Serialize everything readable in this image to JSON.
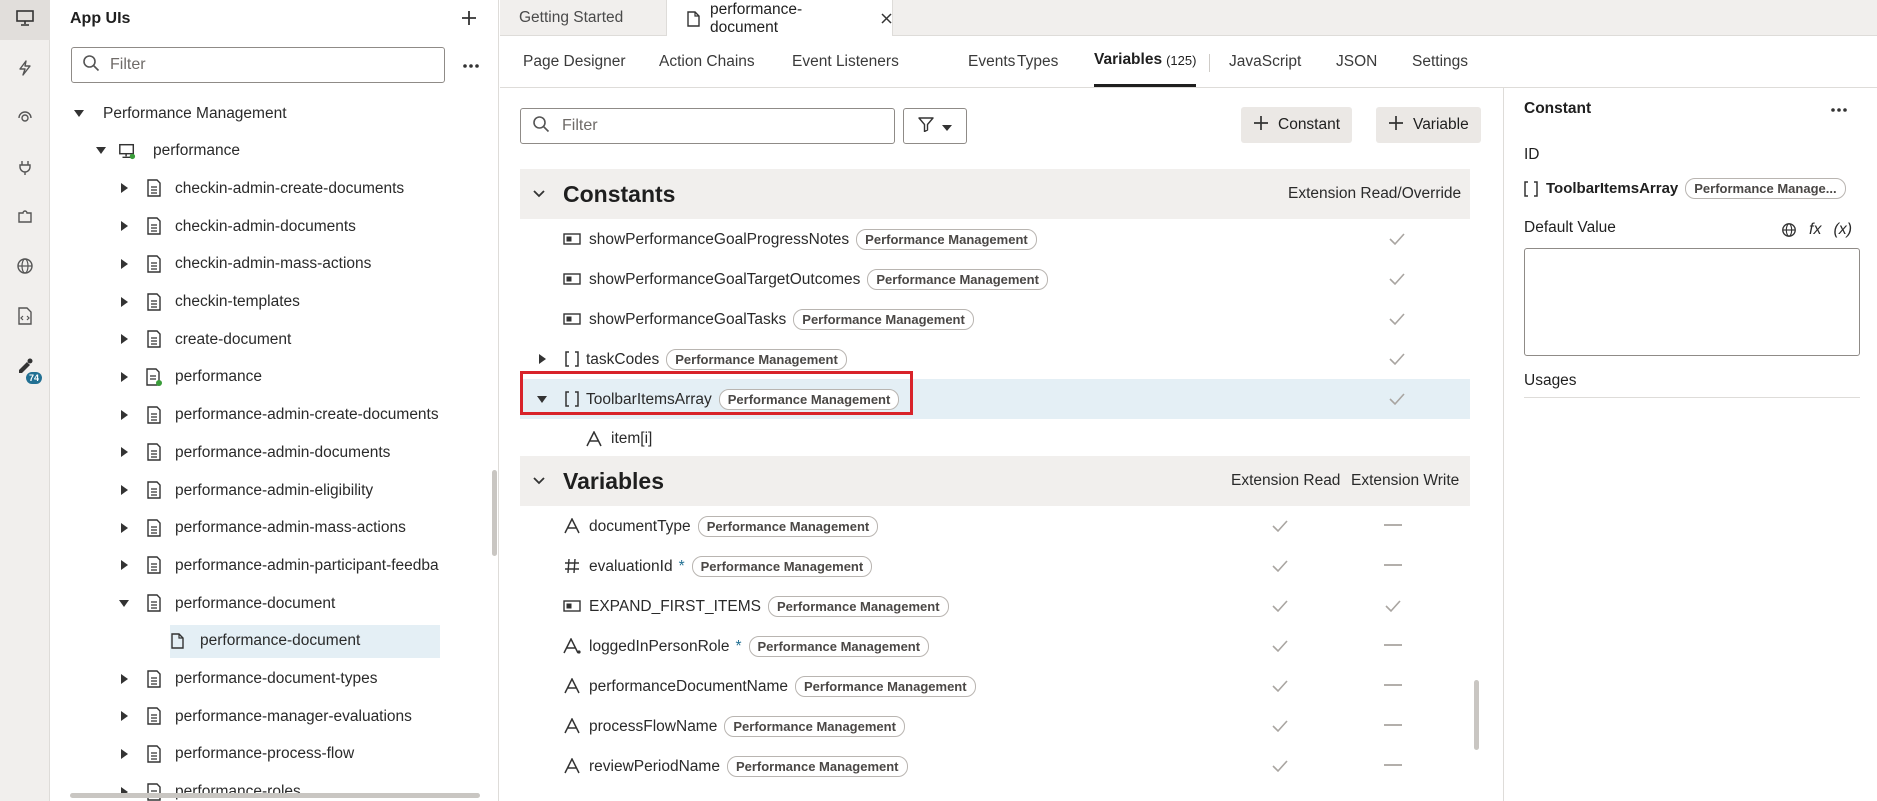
{
  "activity_bar": {
    "items": [
      {
        "icon": "monitor-icon"
      },
      {
        "icon": "lightning-icon"
      },
      {
        "icon": "service-icon"
      },
      {
        "icon": "plug-icon"
      },
      {
        "icon": "puzzle-icon"
      },
      {
        "icon": "globe-icon"
      },
      {
        "icon": "source-file-icon"
      },
      {
        "icon": "components-icon",
        "badge": "74"
      }
    ]
  },
  "sidebar": {
    "title": "App UIs",
    "filter_placeholder": "Filter",
    "tree": [
      {
        "label": "Performance Management",
        "level": 0,
        "expanded": true,
        "icon": "none"
      },
      {
        "label": "performance",
        "level": 1,
        "expanded": true,
        "icon": "monitor"
      },
      {
        "label": "checkin-admin-create-documents",
        "level": 2,
        "icon": "page"
      },
      {
        "label": "checkin-admin-documents",
        "level": 2,
        "icon": "page"
      },
      {
        "label": "checkin-admin-mass-actions",
        "level": 2,
        "icon": "page"
      },
      {
        "label": "checkin-templates",
        "level": 2,
        "icon": "page"
      },
      {
        "label": "create-document",
        "level": 2,
        "icon": "page"
      },
      {
        "label": "performance",
        "level": 2,
        "icon": "page-green"
      },
      {
        "label": "performance-admin-create-documents",
        "level": 2,
        "icon": "page"
      },
      {
        "label": "performance-admin-documents",
        "level": 2,
        "icon": "page"
      },
      {
        "label": "performance-admin-eligibility",
        "level": 2,
        "icon": "page"
      },
      {
        "label": "performance-admin-mass-actions",
        "level": 2,
        "icon": "page"
      },
      {
        "label": "performance-admin-participant-feedba",
        "level": 2,
        "icon": "page"
      },
      {
        "label": "performance-document",
        "level": 2,
        "expanded": true,
        "icon": "page"
      },
      {
        "label": "performance-document",
        "level": 3,
        "icon": "file",
        "selected": true
      },
      {
        "label": "performance-document-types",
        "level": 2,
        "icon": "page"
      },
      {
        "label": "performance-manager-evaluations",
        "level": 2,
        "icon": "page"
      },
      {
        "label": "performance-process-flow",
        "level": 2,
        "icon": "page"
      },
      {
        "label": "performance-roles",
        "level": 2,
        "icon": "page"
      }
    ]
  },
  "tabs": [
    {
      "label": "Getting Started",
      "active": false
    },
    {
      "label": "performance-document",
      "active": true
    }
  ],
  "subnav": [
    {
      "label": "Page Designer"
    },
    {
      "label": "Action Chains"
    },
    {
      "label": "Event Listeners"
    },
    {
      "label": "Events"
    },
    {
      "label": "Types"
    },
    {
      "label": "Variables",
      "count": "(125)",
      "active": true
    },
    {
      "label": "JavaScript"
    },
    {
      "label": "JSON"
    },
    {
      "label": "Settings"
    }
  ],
  "main": {
    "filter_placeholder": "Filter",
    "constant_button": "Constant",
    "variable_button": "Variable",
    "constants": {
      "title": "Constants",
      "column": "Extension Read/Override",
      "rows": [
        {
          "name": "showPerformanceGoalProgressNotes",
          "type": "boolean",
          "badge": "Performance Management",
          "read": true
        },
        {
          "name": "showPerformanceGoalTargetOutcomes",
          "type": "boolean",
          "badge": "Performance Management",
          "read": true
        },
        {
          "name": "showPerformanceGoalTasks",
          "type": "boolean",
          "badge": "Performance Management",
          "read": true
        },
        {
          "name": "taskCodes",
          "type": "array",
          "badge": "Performance Management",
          "read": true,
          "expandable": true,
          "expanded": false
        },
        {
          "name": "ToolbarItemsArray",
          "type": "array",
          "badge": "Performance Management",
          "read": true,
          "expandable": true,
          "expanded": true,
          "highlight": true
        },
        {
          "name": "item[i]",
          "type": "string",
          "badge": "",
          "child": true
        }
      ]
    },
    "variables": {
      "title": "Variables",
      "col_read": "Extension Read",
      "col_write": "Extension Write",
      "rows": [
        {
          "name": "documentType",
          "type": "string",
          "badge": "Performance Management",
          "star": "",
          "read": true,
          "write": false
        },
        {
          "name": "evaluationId",
          "type": "number",
          "badge": "Performance Management",
          "star": "*",
          "read": true,
          "write": false
        },
        {
          "name": "EXPAND_FIRST_ITEMS",
          "type": "boolean",
          "badge": "Performance Management",
          "star": "",
          "read": true,
          "write": true
        },
        {
          "name": "loggedInPersonRole",
          "type": "string-sub",
          "badge": "Performance Management",
          "star": "*",
          "read": true,
          "write": false
        },
        {
          "name": "performanceDocumentName",
          "type": "string",
          "badge": "Performance Management",
          "star": "",
          "read": true,
          "write": false
        },
        {
          "name": "processFlowName",
          "type": "string",
          "badge": "Performance Management",
          "star": "",
          "read": true,
          "write": false
        },
        {
          "name": "reviewPeriodName",
          "type": "string",
          "badge": "Performance Management",
          "star": "",
          "read": true,
          "write": false
        }
      ]
    }
  },
  "properties": {
    "title": "Constant",
    "id_label": "ID",
    "id_value": "ToolbarItemsArray",
    "id_badge": "Performance Manage...",
    "default_value_label": "Default Value",
    "fx_label": "fx",
    "x_label": "(x)",
    "usages_label": "Usages"
  },
  "colors": {
    "accent": "#227093",
    "highlight_row": "#e4eff5",
    "callout_red": "#d8232a",
    "panel_bg": "#f1efed"
  }
}
